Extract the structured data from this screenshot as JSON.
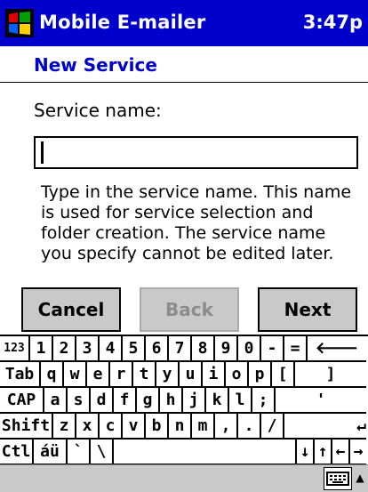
{
  "titlebar": {
    "app_title": "Mobile E-mailer",
    "time": "3:47p"
  },
  "page": {
    "title": "New Service"
  },
  "form": {
    "name_label": "Service name:",
    "name_value": "",
    "help_text": "Type in the service name. This name is used for service selection and folder creation. The service name you specify cannot be edited later."
  },
  "buttons": {
    "cancel": "Cancel",
    "back": "Back",
    "next": "Next"
  },
  "keyboard": {
    "row1": [
      "123",
      "1",
      "2",
      "3",
      "4",
      "5",
      "6",
      "7",
      "8",
      "9",
      "0",
      "-",
      "=",
      "🡐"
    ],
    "row2": [
      "Tab",
      "q",
      "w",
      "e",
      "r",
      "t",
      "y",
      "u",
      "i",
      "o",
      "p",
      "[",
      "]"
    ],
    "row3": [
      "CAP",
      "a",
      "s",
      "d",
      "f",
      "g",
      "h",
      "j",
      "k",
      "l",
      ";",
      "'"
    ],
    "row4": [
      "Shift",
      "z",
      "x",
      "c",
      "v",
      "b",
      "n",
      "m",
      ",",
      ".",
      "/",
      "↵"
    ],
    "row5": [
      "Ctl",
      "áü",
      "`",
      "\\",
      "",
      "↓",
      "↑",
      "←",
      "→"
    ]
  },
  "colors": {
    "titlebar": "#0000cc",
    "button_face": "#c9c9c9",
    "disabled_text": "#8c8c8c"
  },
  "icons": {
    "start": "windows-flag-icon",
    "keyboard": "keyboard-icon"
  }
}
